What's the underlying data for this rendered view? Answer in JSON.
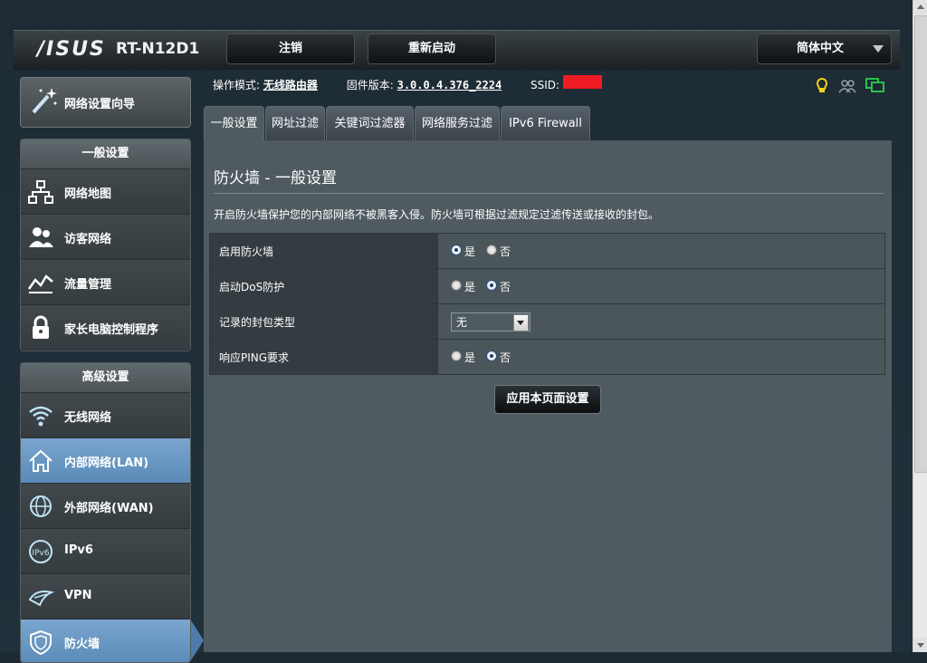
{
  "header": {
    "brand": "/ISUS",
    "model": "RT-N12D1",
    "logout_label": "注销",
    "reboot_label": "重新启动",
    "language": "简体中文"
  },
  "info": {
    "mode_label": "操作模式:",
    "mode_value": "无线路由器",
    "firmware_label": "固件版本:",
    "firmware_value": "3.0.0.4.376_2224",
    "ssid_label": "SSID:"
  },
  "sidebar": {
    "wizard_label": "网络设置向导",
    "general_header": "一般设置",
    "general_items": [
      {
        "label": "网络地图"
      },
      {
        "label": "访客网络"
      },
      {
        "label": "流量管理"
      },
      {
        "label": "家长电脑控制程序"
      }
    ],
    "advanced_header": "高级设置",
    "advanced_items": [
      {
        "label": "无线网络"
      },
      {
        "label": "内部网络(LAN)"
      },
      {
        "label": "外部网络(WAN)"
      },
      {
        "label": "IPv6"
      },
      {
        "label": "VPN"
      },
      {
        "label": "防火墙"
      }
    ]
  },
  "tabs": [
    {
      "label": "一般设置",
      "active": true
    },
    {
      "label": "网址过滤"
    },
    {
      "label": "关键词过滤器"
    },
    {
      "label": "网络服务过滤"
    },
    {
      "label": "IPv6 Firewall"
    }
  ],
  "content": {
    "title": "防火墙 - 一般设置",
    "description": "开启防火墙保护您的内部网络不被黑客入侵。防火墙可根据过滤规定过滤传送或接收的封包。",
    "rows": [
      {
        "label": "启用防火墙",
        "yes": "是",
        "no": "否",
        "selected": "是"
      },
      {
        "label": "启动DoS防护",
        "yes": "是",
        "no": "否",
        "selected": "否"
      },
      {
        "label": "记录的封包类型",
        "select_value": "无"
      },
      {
        "label": "响应PING要求",
        "yes": "是",
        "no": "否",
        "selected": "否"
      }
    ],
    "apply_label": "应用本页面设置"
  },
  "colors": {
    "accent_active": "#5a8ab7",
    "ssid_redaction": "#ef1b24",
    "status_yellow": "#f2d21a",
    "status_green": "#29c24a"
  },
  "icons": [
    "wand-icon",
    "network-map-icon",
    "guest-network-icon",
    "traffic-icon",
    "lock-icon",
    "wifi-icon",
    "home-icon",
    "globe-icon",
    "ipv6-icon",
    "vpn-icon",
    "shield-icon",
    "lightbulb-icon",
    "users-icon",
    "monitor-icon"
  ]
}
